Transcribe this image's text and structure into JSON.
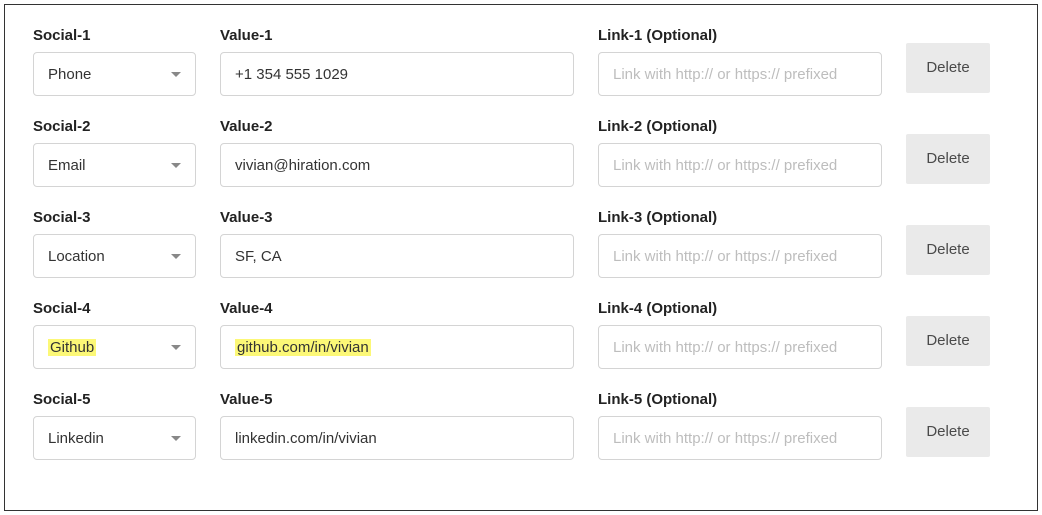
{
  "link_placeholder": "Link with http:// or https:// prefixed",
  "delete_label": "Delete",
  "rows": [
    {
      "social_label": "Social-1",
      "value_label": "Value-1",
      "link_label": "Link-1 (Optional)",
      "social_value": "Phone",
      "value_value": "+1 354 555 1029",
      "link_value": "",
      "highlight": false
    },
    {
      "social_label": "Social-2",
      "value_label": "Value-2",
      "link_label": "Link-2 (Optional)",
      "social_value": "Email",
      "value_value": "vivian@hiration.com",
      "link_value": "",
      "highlight": false
    },
    {
      "social_label": "Social-3",
      "value_label": "Value-3",
      "link_label": "Link-3 (Optional)",
      "social_value": "Location",
      "value_value": "SF, CA",
      "link_value": "",
      "highlight": false
    },
    {
      "social_label": "Social-4",
      "value_label": "Value-4",
      "link_label": "Link-4 (Optional)",
      "social_value": "Github",
      "value_value": "github.com/in/vivian",
      "link_value": "",
      "highlight": true
    },
    {
      "social_label": "Social-5",
      "value_label": "Value-5",
      "link_label": "Link-5 (Optional)",
      "social_value": "Linkedin",
      "value_value": "linkedin.com/in/vivian",
      "link_value": "",
      "highlight": false
    }
  ]
}
